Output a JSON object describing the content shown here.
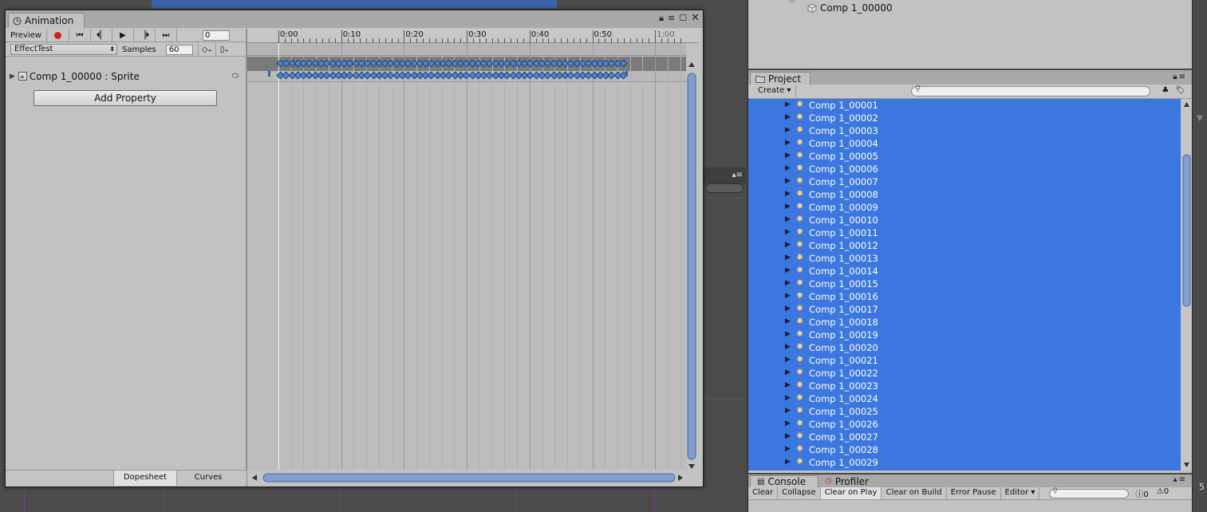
{
  "colors": {
    "selection_blue": "#3c77e0",
    "record_red": "#d21f1f",
    "keyframe_blue": "#4e86d8",
    "panel_grey": "#c2c2c2"
  },
  "hierarchy": {
    "item_label": "Comp 1_00000"
  },
  "animation": {
    "tab_title": "Animation",
    "preview_label": "Preview",
    "current_frame": "0",
    "clip_name": "EffectTest",
    "samples_label": "Samples",
    "samples_value": "60",
    "property_label": "Comp 1_00000 : Sprite",
    "add_property_label": "Add Property",
    "tabs": {
      "dopesheet": "Dopesheet",
      "curves": "Curves"
    },
    "ruler_labels": [
      "0:00",
      "0:10",
      "0:20",
      "0:30",
      "0:40",
      "0:50",
      "1:00"
    ],
    "keyframe_count": 60,
    "icons": {
      "tab": "clock-icon",
      "record": "record-icon",
      "first": "first-key-icon",
      "prev": "prev-key-icon",
      "play": "play-icon",
      "next": "next-key-icon",
      "last": "last-key-icon",
      "add_key": "add-keyframe-icon",
      "add_event": "add-event-icon"
    }
  },
  "project": {
    "tab_title": "Project",
    "create_label": "Create",
    "items": [
      "Comp 1_00001",
      "Comp 1_00002",
      "Comp 1_00003",
      "Comp 1_00004",
      "Comp 1_00005",
      "Comp 1_00006",
      "Comp 1_00007",
      "Comp 1_00008",
      "Comp 1_00009",
      "Comp 1_00010",
      "Comp 1_00011",
      "Comp 1_00012",
      "Comp 1_00013",
      "Comp 1_00014",
      "Comp 1_00015",
      "Comp 1_00016",
      "Comp 1_00017",
      "Comp 1_00018",
      "Comp 1_00019",
      "Comp 1_00020",
      "Comp 1_00021",
      "Comp 1_00022",
      "Comp 1_00023",
      "Comp 1_00024",
      "Comp 1_00025",
      "Comp 1_00026",
      "Comp 1_00027",
      "Comp 1_00028",
      "Comp 1_00029"
    ]
  },
  "console": {
    "tabs": [
      "Console",
      "Profiler"
    ],
    "buttons": [
      "Clear",
      "Collapse",
      "Clear on Play",
      "Clear on Build",
      "Error Pause",
      "Editor"
    ],
    "counts": [
      "0",
      "0"
    ]
  },
  "side": {
    "edge_number": "5"
  }
}
